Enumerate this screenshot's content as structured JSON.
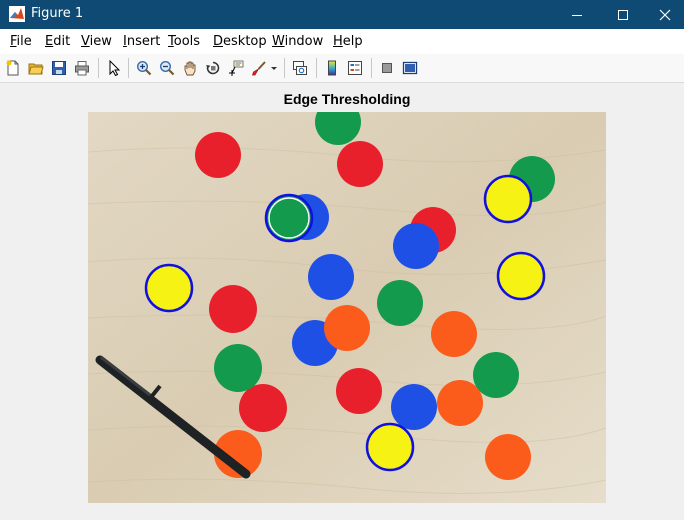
{
  "window": {
    "title": "Figure 1",
    "controls": [
      "minimize",
      "maximize",
      "close"
    ]
  },
  "menu": {
    "items": [
      {
        "label": "File",
        "mnemonic": "F",
        "rest": "ile"
      },
      {
        "label": "Edit",
        "mnemonic": "E",
        "rest": "dit"
      },
      {
        "label": "View",
        "mnemonic": "V",
        "rest": "iew"
      },
      {
        "label": "Insert",
        "mnemonic": "I",
        "rest": "nsert"
      },
      {
        "label": "Tools",
        "mnemonic": "T",
        "rest": "ools"
      },
      {
        "label": "Desktop",
        "mnemonic": "D",
        "rest": "esktop"
      },
      {
        "label": "Window",
        "mnemonic": "W",
        "rest": "indow"
      },
      {
        "label": "Help",
        "mnemonic": "H",
        "rest": "elp"
      }
    ]
  },
  "toolbar": {
    "icons": [
      "new-figure-icon",
      "open-file-icon",
      "save-icon",
      "print-icon",
      "edit-plot-icon",
      "zoom-in-icon",
      "zoom-out-icon",
      "pan-icon",
      "rotate-3d-icon",
      "data-cursor-icon",
      "brush-icon",
      "link-plot-icon",
      "colorbar-icon",
      "legend-icon",
      "hide-plot-tools-icon",
      "show-plot-tools-icon"
    ]
  },
  "figure": {
    "title": "Edge Thresholding"
  },
  "colors": {
    "titlebar": "#0e4a73",
    "table": "#ddd2bd",
    "red": "#e8202c",
    "blue": "#1e50e6",
    "green": "#139a4c",
    "orange": "#fb5c1c",
    "yellow": "#f6f214",
    "highlight_stroke": "#1010e0"
  }
}
